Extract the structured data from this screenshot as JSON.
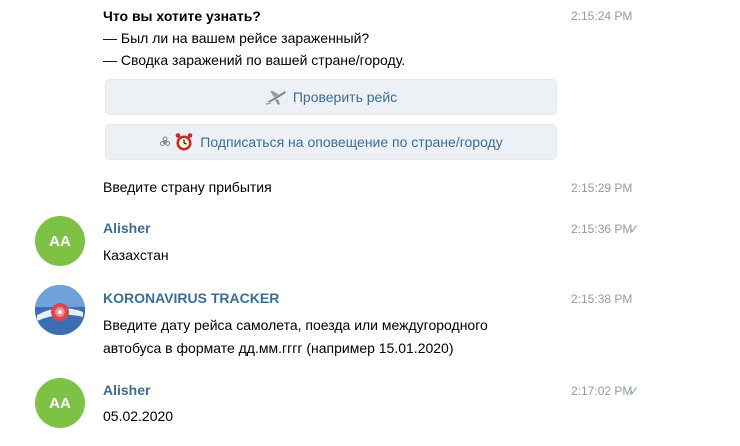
{
  "messages": {
    "m1": {
      "title": "Что вы хотите узнать?",
      "line1": "— Был ли на вашем рейсе зараженный?",
      "line2": "— Сводка заражений по вашей стране/городу.",
      "time": "2:15:24 PM",
      "buttons": [
        {
          "label": "Проверить рейс",
          "icon": "airplane-icon"
        },
        {
          "label": "Подписаться на оповещение по стране/городу",
          "icon": "biohazard-alarm-icon"
        }
      ]
    },
    "m2": {
      "text": "Введите страну прибытия",
      "time": "2:15:29 PM"
    },
    "m3": {
      "sender": "Alisher",
      "avatar_initials": "AA",
      "text": "Казахстан",
      "time": "2:15:36 PM",
      "check": "✓"
    },
    "m4": {
      "sender": "KORONAVIRUS TRACKER",
      "line1": "Введите дату рейса самолета, поезда или междугородного",
      "line2": "автобуса в формате дд.мм.гггг (например 15.01.2020)",
      "time": "2:15:38 PM"
    },
    "m5": {
      "sender": "Alisher",
      "avatar_initials": "AA",
      "text": "05.02.2020",
      "time": "2:17:02 PM",
      "check": "✓"
    }
  },
  "colors": {
    "sender": "#3a6d99",
    "time": "#999999",
    "check": "#6aa7d9",
    "avatar_user": "#7dc145",
    "button_bg": "#edf1f5"
  }
}
